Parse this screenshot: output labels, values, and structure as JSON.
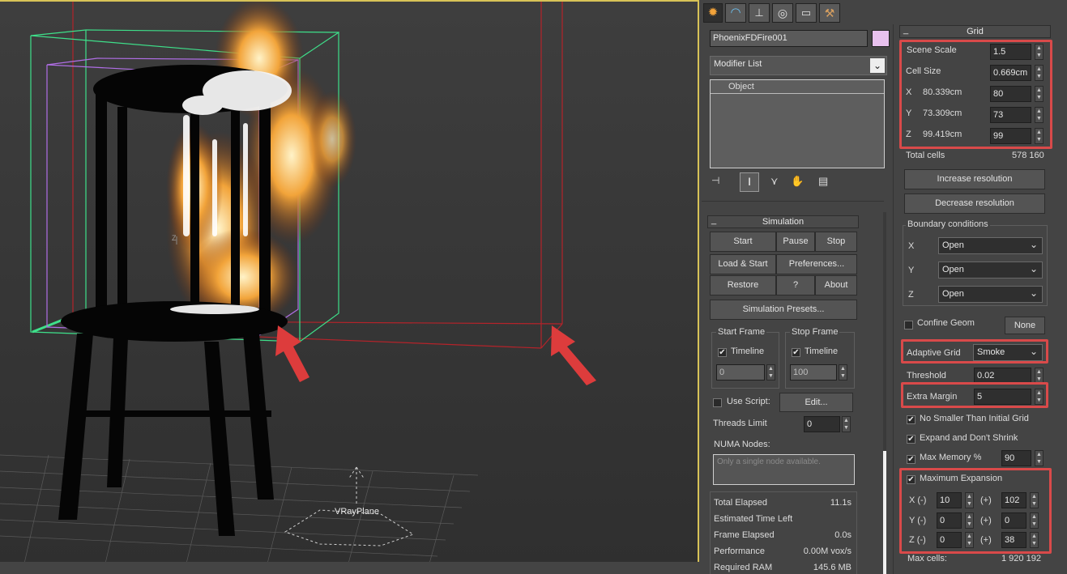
{
  "viewport": {
    "object_label": "VRayPlane",
    "axis_label": "Z"
  },
  "command_panel": {
    "tabs": [
      "create-icon",
      "modify-icon",
      "hierarchy-icon",
      "motion-icon",
      "display-icon",
      "utilities-icon"
    ],
    "object_name": "PhoenixFDFire001",
    "object_color": "#e8c1ee",
    "modifier_list": "Modifier List",
    "stack_header": "Object"
  },
  "simulation": {
    "title": "Simulation",
    "start": "Start",
    "pause": "Pause",
    "stop": "Stop",
    "load_start": "Load & Start",
    "preferences": "Preferences...",
    "restore": "Restore",
    "help": "?",
    "about": "About",
    "presets": "Simulation Presets...",
    "start_frame": {
      "title": "Start Frame",
      "timeline": "Timeline",
      "value": "0"
    },
    "stop_frame": {
      "title": "Stop Frame",
      "timeline": "Timeline",
      "value": "100"
    },
    "use_script": "Use Script:",
    "edit": "Edit...",
    "threads_limit": "Threads Limit",
    "threads_value": "0",
    "numa_nodes": "NUMA Nodes:",
    "numa_placeholder": "Only a single node available.",
    "stats": [
      {
        "label": "Total Elapsed",
        "value": "11.1s"
      },
      {
        "label": "Estimated Time Left",
        "value": ""
      },
      {
        "label": "Frame Elapsed",
        "value": "0.0s"
      },
      {
        "label": "Performance",
        "value": "0.00M vox/s"
      },
      {
        "label": "Required RAM",
        "value": "145.6 MB"
      }
    ]
  },
  "grid": {
    "title": "Grid",
    "scene_scale_label": "Scene Scale",
    "scene_scale": "1.5",
    "cell_size_label": "Cell Size",
    "cell_size": "0.669cm",
    "x_label": "X",
    "x_size": "80.339cm",
    "x_cells": "80",
    "y_label": "Y",
    "y_size": "73.309cm",
    "y_cells": "73",
    "z_label": "Z",
    "z_size": "99.419cm",
    "z_cells": "99",
    "total_cells_label": "Total cells",
    "total_cells": "578 160",
    "increase_resolution": "Increase resolution",
    "decrease_resolution": "Decrease resolution",
    "boundary_title": "Boundary conditions",
    "boundary_x": "Open",
    "boundary_y": "Open",
    "boundary_z": "Open",
    "confine_geom": "Confine Geom",
    "none_button": "None",
    "adaptive_grid_label": "Adaptive Grid",
    "adaptive_grid": "Smoke",
    "threshold_label": "Threshold",
    "threshold": "0.02",
    "extra_margin_label": "Extra Margin",
    "extra_margin": "5",
    "no_smaller": "No Smaller Than Initial Grid",
    "expand_no_shrink": "Expand and Don't Shrink",
    "max_memory_label": "Max Memory %",
    "max_memory": "90",
    "max_expansion": "Maximum Expansion",
    "x_minus_label": "X (-)",
    "x_minus": "10",
    "x_plus": "102",
    "y_minus_label": "Y (-)",
    "y_minus": "0",
    "y_plus": "0",
    "z_minus_label": "Z (-)",
    "z_minus": "0",
    "z_plus": "38",
    "plus_label": "(+)",
    "max_cells_label": "Max cells:",
    "max_cells": "1 920 192"
  },
  "colors": {
    "highlight": "#d94a4a",
    "active_viewport_border": "#d7c257"
  }
}
